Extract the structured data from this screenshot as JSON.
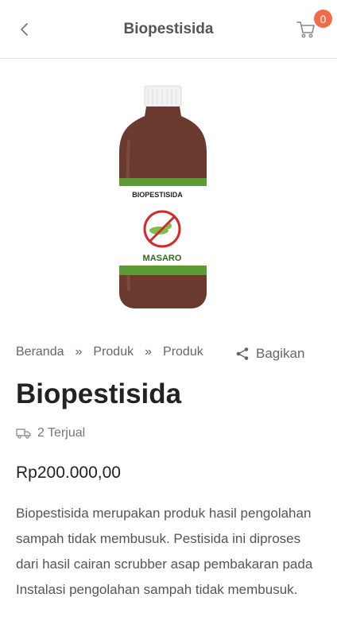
{
  "header": {
    "title": "Biopestisida",
    "cart_count": "0",
    "back_icon": "chevron-left-icon",
    "cart_icon": "cart-icon"
  },
  "product": {
    "image_label_top": "BIOPESTISIDA",
    "image_label_brand": "MASARO",
    "name": "Biopestisida",
    "sold": "2 Terjual",
    "price": "Rp200.000,00",
    "description": "Biopestisida merupakan produk hasil pengolahan sampah tidak membusuk. Pestisida ini diproses dari hasil cairan scrubber asap pembakaran pada Instalasi pengolahan sampah tidak membusuk."
  },
  "breadcrumb": {
    "items": [
      "Beranda",
      "Produk",
      "Produk"
    ],
    "separator": "»"
  },
  "share": {
    "label": "Bagikan",
    "icon": "share-icon"
  },
  "colors": {
    "accent_badge": "#f36b4b",
    "liquid": "#6b3a2e",
    "label_green": "#4f8a2f"
  }
}
